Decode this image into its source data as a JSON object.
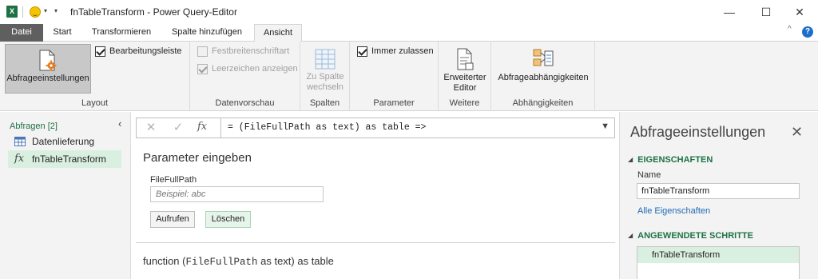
{
  "titlebar": {
    "app_icon": "excel-icon",
    "title": "fnTableTransform - Power Query-Editor",
    "minimize": "—",
    "maximize": "☐",
    "close": "✕"
  },
  "tabs": {
    "file": "Datei",
    "items": [
      "Start",
      "Transformieren",
      "Spalte hinzufügen",
      "Ansicht"
    ],
    "active": "Ansicht"
  },
  "ribbon": {
    "layout": {
      "label": "Layout",
      "query_settings": "Abfrageeinstellungen",
      "formula_bar": "Bearbeitungsleiste"
    },
    "data_preview": {
      "label": "Datenvorschau",
      "monospace": "Festbreitenschriftart",
      "whitespace": "Leerzeichen anzeigen"
    },
    "columns": {
      "label": "Spalten",
      "go_to_column_line1": "Zu Spalte",
      "go_to_column_line2": "wechseln"
    },
    "parameters": {
      "label": "Parameter",
      "always_allow": "Immer zulassen"
    },
    "more": {
      "label": "Weitere",
      "advanced_editor_line1": "Erweiterter",
      "advanced_editor_line2": "Editor"
    },
    "dependencies": {
      "label": "Abhängigkeiten",
      "query_dependencies": "Abfrageabhängigkeiten"
    }
  },
  "queries": {
    "header": "Abfragen [2]",
    "items": [
      {
        "label": "Datenlieferung",
        "icon": "table-icon"
      },
      {
        "label": "fnTableTransform",
        "icon": "function-icon"
      }
    ]
  },
  "formula_bar": {
    "fx": "fx",
    "formula": "= (FileFullPath as text) as table =>"
  },
  "main": {
    "title": "Parameter eingeben",
    "field_label": "FileFullPath",
    "field_placeholder": "Beispiel: abc",
    "invoke_button": "Aufrufen",
    "clear_button": "Löschen",
    "signature_prefix": "function (",
    "signature_param": "FileFullPath",
    "signature_suffix": " as text) as table"
  },
  "query_settings": {
    "title": "Abfrageeinstellungen",
    "properties_header": "EIGENSCHAFTEN",
    "name_label": "Name",
    "name_value": "fnTableTransform",
    "all_properties_link": "Alle Eigenschaften",
    "applied_steps_header": "ANGEWENDETE SCHRITTE",
    "steps": [
      "fnTableTransform"
    ]
  }
}
